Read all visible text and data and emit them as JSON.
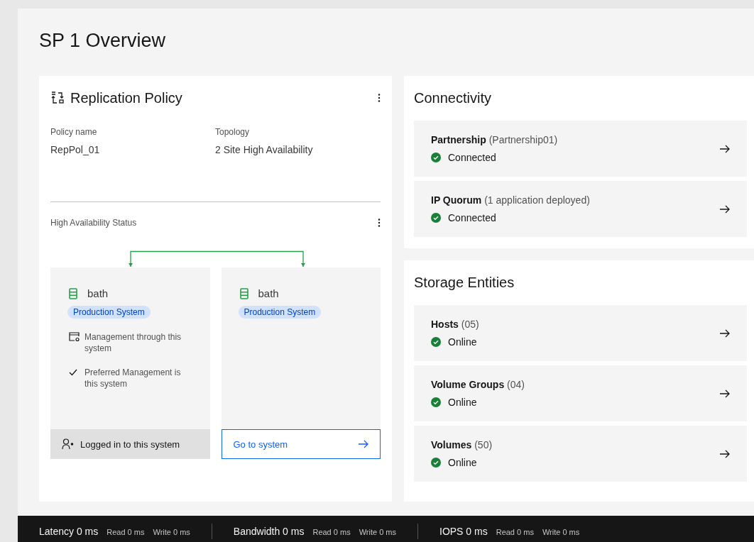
{
  "page": {
    "title": "SP 1 Overview"
  },
  "replication_policy": {
    "title": "Replication Policy",
    "fields": [
      {
        "label": "Policy name",
        "value": "RepPol_01"
      },
      {
        "label": "Topology",
        "value": "2 Site High Availability"
      }
    ],
    "ha_status": {
      "title": "High Availability Status",
      "systems": [
        {
          "name": "bath",
          "tag": "Production System",
          "notes": [
            {
              "kind": "management",
              "text": "Management through this system"
            },
            {
              "kind": "check",
              "text": "Preferred Management is this system"
            }
          ],
          "footer": {
            "kind": "logged-in",
            "label": "Logged in to this system"
          }
        },
        {
          "name": "bath",
          "tag": "Production System",
          "footer": {
            "kind": "link",
            "label": "Go to system"
          }
        }
      ]
    }
  },
  "connectivity": {
    "title": "Connectivity",
    "items": [
      {
        "name": "Partnership",
        "detail": "(Partnership01)",
        "status": "Connected"
      },
      {
        "name": "IP Quorum",
        "detail": "(1 application deployed)",
        "status": "Connected"
      }
    ]
  },
  "storage_entities": {
    "title": "Storage Entities",
    "items": [
      {
        "name": "Hosts",
        "detail": "(05)",
        "status": "Online"
      },
      {
        "name": "Volume Groups",
        "detail": "(04)",
        "status": "Online"
      },
      {
        "name": "Volumes",
        "detail": "(50)",
        "status": "Online"
      }
    ]
  },
  "status_bar": {
    "groups": [
      {
        "label": "Latency 0 ms",
        "read": "Read 0 ms",
        "write": "Write 0 ms"
      },
      {
        "label": "Bandwidth 0 ms",
        "read": "Read 0 ms",
        "write": "Write 0 ms"
      },
      {
        "label": "IOPS 0 ms",
        "read": "Read 0 ms",
        "write": "Write 0 ms"
      }
    ]
  }
}
